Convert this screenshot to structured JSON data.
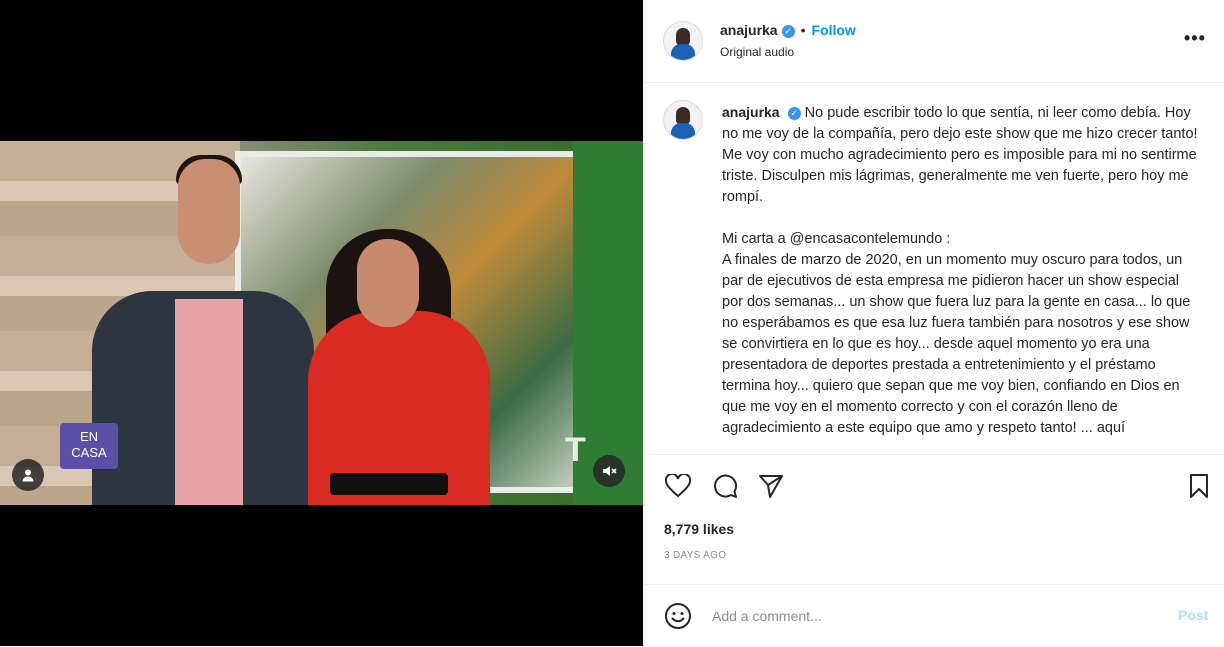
{
  "post": {
    "username": "anajurka",
    "separator": "•",
    "follow_label": "Follow",
    "audio_label": "Original audio",
    "more_label": "•••",
    "verified_glyph": "✓"
  },
  "video": {
    "logo_text_line1": "EN",
    "logo_text_line2": "CASA",
    "network_mark": "T"
  },
  "caption": {
    "text": "No pude escribir todo lo que sentía, ni leer como debía. Hoy no me voy de la compañía, pero dejo este show que me hizo crecer tanto! Me voy con mucho agradecimiento pero es imposible para mi no sentirme triste. Disculpen mis lágrimas, generalmente me ven fuerte, pero hoy me rompí.\n\nMi carta a @encasacontelemundo :\nA finales de marzo de 2020, en un momento muy oscuro para todos, un par de ejecutivos de esta empresa me pidieron hacer un show especial por dos semanas... un show que fuera luz para la gente en casa... lo que no esperábamos es que esa luz fuera también para nosotros y ese show se convirtiera en lo que es hoy... desde aquel momento yo era una presentadora de deportes prestada a entretenimiento y el préstamo termina hoy... quiero que sepan que me voy bien, confiando en Dios en que me voy en el momento correcto y con el corazón lleno de agradecimiento a este equipo que amo y respeto tanto! ... aquí"
  },
  "stats": {
    "likes": "8,779 likes",
    "time": "3 DAYS AGO"
  },
  "comment": {
    "placeholder": "Add a comment...",
    "post_label": "Post"
  },
  "icons": {
    "like": "heart-icon",
    "comment": "comment-bubble-icon",
    "share": "paper-plane-icon",
    "save": "bookmark-icon",
    "emoji": "emoji-smile-icon",
    "mute": "speaker-muted-icon",
    "tagged": "user-tag-icon"
  }
}
